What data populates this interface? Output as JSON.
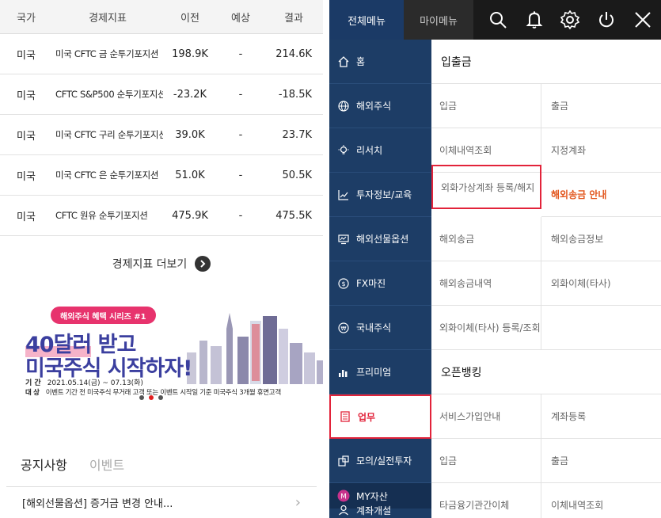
{
  "indicators": {
    "headers": {
      "country": "국가",
      "indicator": "경제지표",
      "previous": "이전",
      "expected": "예상",
      "result": "결과"
    },
    "rows": [
      {
        "country": "미국",
        "indicator": "미국 CFTC 금 순투기포지션",
        "previous": "198.9K",
        "expected": "-",
        "result": "214.6K"
      },
      {
        "country": "미국",
        "indicator": "CFTC S&P500 순투기포지션",
        "previous": "-23.2K",
        "expected": "-",
        "result": "-18.5K"
      },
      {
        "country": "미국",
        "indicator": "미국 CFTC 구리 순투기포지션",
        "previous": "39.0K",
        "expected": "-",
        "result": "23.7K"
      },
      {
        "country": "미국",
        "indicator": "미국 CFTC 은 순투기포지션",
        "previous": "51.0K",
        "expected": "-",
        "result": "50.5K"
      },
      {
        "country": "미국",
        "indicator": "CFTC 원유 순투기포지션",
        "previous": "475.9K",
        "expected": "-",
        "result": "475.5K"
      }
    ],
    "more_label": "경제지표 더보기"
  },
  "banner": {
    "series_pill": "해외주식 혜택 시리즈 #1",
    "headline_line1_hl": "40달러",
    "headline_line1_rest": "받고",
    "headline_line2": "미국주식 시작하자!",
    "period_label": "기 간",
    "period_value": "2021.05.14(금) ~ 07.13(화)",
    "target_label": "대 상",
    "target_value": "이벤트 기간 전 미국주식 무거래 고객 또는 이벤트 시작일 기준 미국주식 3개월 휴면고객"
  },
  "notices": {
    "tab_notice": "공지사항",
    "tab_event": "이벤트",
    "first_item": "[해외선물옵션] 증거금 변경 안내..."
  },
  "menu": {
    "tab_all": "전체메뉴",
    "tab_my": "마이메뉴",
    "icons": [
      "search-icon",
      "bell-icon",
      "gear-icon",
      "power-icon",
      "close-icon"
    ],
    "sidebar": [
      {
        "label": "홈",
        "icon": "home-icon"
      },
      {
        "label": "해외주식",
        "icon": "globe-icon"
      },
      {
        "label": "리서치",
        "icon": "bulb-icon"
      },
      {
        "label": "투자정보/교육",
        "icon": "chart-icon"
      },
      {
        "label": "해외선물옵션",
        "icon": "monitor-icon"
      },
      {
        "label": "FX마진",
        "icon": "dollar-icon"
      },
      {
        "label": "국내주식",
        "icon": "won-icon"
      },
      {
        "label": "프리미엄",
        "icon": "bar-icon"
      },
      {
        "label": "업무",
        "icon": "doc-icon"
      },
      {
        "label": "모의/실전투자",
        "icon": "sim-icon"
      },
      {
        "label": "MY자산",
        "icon": "coin-icon"
      },
      {
        "label": "계좌개설",
        "icon": "user-icon"
      }
    ],
    "section1_title": "입출금",
    "section1_items": [
      "입금",
      "출금",
      "이체내역조회",
      "지정계좌",
      "외화가상계좌 등록/해지",
      "해외송금 안내",
      "해외송금",
      "해외송금정보",
      "해외송금내역",
      "외화이체(타사)",
      "외화이체(타사) 등록/조회",
      ""
    ],
    "section2_title": "오픈뱅킹",
    "section2_items": [
      "서비스가입안내",
      "계좌등록",
      "입금",
      "출금",
      "타금융기관간이체",
      "이체내역조회"
    ]
  },
  "colors": {
    "nav_blue": "#1d3d66",
    "accent_red": "#e2233a",
    "orange": "#e2551c",
    "banner_blue": "#3b3f9f",
    "banner_pink": "#e7336d"
  }
}
